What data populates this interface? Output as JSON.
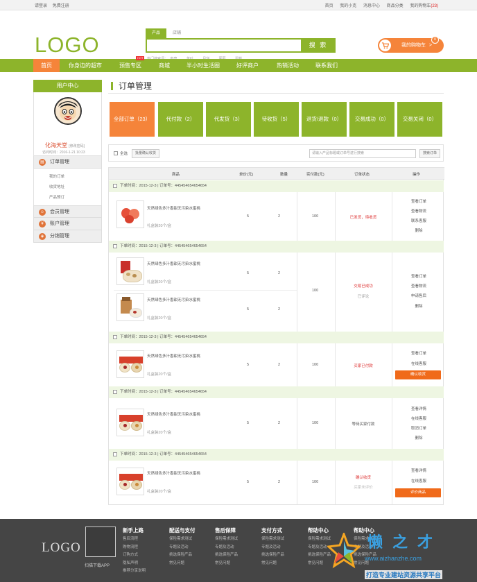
{
  "topbar": {
    "login": "请登录",
    "register": "免费注册",
    "links": [
      "首页",
      "我的小克",
      "消息中心",
      "商品分类",
      "我的购物车"
    ],
    "cart_count": "(23)"
  },
  "header": {
    "logo": "LOGO",
    "search_tabs": [
      "产品",
      "店铺"
    ],
    "search_button": "搜 索",
    "hot_label": "热门搜索词：",
    "hot_words": [
      "肉糜",
      "茶叶",
      "月饼",
      "葡萄",
      "蛋糕"
    ],
    "cart_label": "我的购物车",
    "cart_arrow": ">",
    "cart_badge": "0"
  },
  "nav": {
    "items": [
      "首页",
      "你身边的超市",
      "预售专区",
      "商城",
      "半小时生活圈",
      "好评商户",
      "热销活动",
      "联系我们"
    ],
    "hot_tag": "HOT"
  },
  "sidebar": {
    "title": "用户中心",
    "user_name": "化海天堂",
    "edit_password": "[修改密码]",
    "visit_time": "访问时间：2016-1-21 10:23",
    "sections": [
      {
        "label": "订单管理",
        "sub": [
          "我的订单",
          "收货地址",
          "产品预订"
        ]
      },
      {
        "label": "会员管理"
      },
      {
        "label": "账户管理"
      },
      {
        "label": "分销管理"
      }
    ]
  },
  "main": {
    "title": "订单管理",
    "status_tabs": [
      "全部订单（23）",
      "代付款（2）",
      "代发货（3）",
      "待收货（5）",
      "退货/退款（0）",
      "交易成功（0）",
      "交易关闭（0）"
    ],
    "select_all": "全选",
    "batch_confirm": "批量确认收货",
    "search_placeholder": "请输入产品标题或订单号进行搜索",
    "search_button": "搜索订单",
    "columns": [
      "商品",
      "单价(元)",
      "数量",
      "实付款(元)",
      "订单状态",
      "操作"
    ],
    "orders": [
      {
        "header": "下单时间：2015-12-3 | 订单号：445454654654654",
        "items": [
          {
            "name": "天然绿色多汁香甜无污染水蜜桃",
            "spec": "礼盒装20个/盒",
            "price": "5",
            "qty": "2"
          }
        ],
        "paid": "100",
        "status": [
          "已发货，待收货"
        ],
        "actions": [
          "查看订单",
          "查看物流",
          "联系客服",
          "删除"
        ],
        "button": ""
      },
      {
        "header": "下单时间：2015-12-3 | 订单号：445454654654654",
        "items": [
          {
            "name": "天然绿色多汁香甜无污染水蜜桃",
            "spec": "礼盒装20个/盒",
            "price": "5",
            "qty": "2"
          },
          {
            "name": "天然绿色多汁香甜无污染水蜜桃",
            "spec": "礼盒装20个/盒",
            "price": "5",
            "qty": "2"
          }
        ],
        "paid": "100",
        "status": [
          "交易已成功",
          "已评论"
        ],
        "actions": [
          "查看订单",
          "查看物流",
          "申请售后",
          "删除"
        ],
        "button": ""
      },
      {
        "header": "下单时间：2015-12-3 | 订单号：445454654654654",
        "items": [
          {
            "name": "天然绿色多汁香甜无污染水蜜桃",
            "spec": "礼盒装20个/盒",
            "price": "5",
            "qty": "2"
          }
        ],
        "paid": "100",
        "status": [
          "买家已付款"
        ],
        "actions": [
          "查看订单",
          "在线客服"
        ],
        "button": "确认收货"
      },
      {
        "header": "下单时间：2015-12-3 | 订单号：445454654654654",
        "items": [
          {
            "name": "天然绿色多汁香甜无污染水蜜桃",
            "spec": "礼盒装20个/盒",
            "price": "5",
            "qty": "2"
          }
        ],
        "paid": "100",
        "status": [
          "等待买家付款"
        ],
        "actions": [
          "查看详情",
          "在线客服",
          "取消订单",
          "删除"
        ],
        "button": ""
      },
      {
        "header": "下单时间：2015-12-3 | 订单号：445454654654654",
        "items": [
          {
            "name": "天然绿色多汁香甜无污染水蜜桃",
            "spec": "礼盒装20个/盒",
            "price": "5",
            "qty": "2"
          }
        ],
        "paid": "100",
        "status": [
          "确认收货",
          "买家未评价"
        ],
        "actions": [
          "查看详情",
          "在线客服"
        ],
        "button": "评价商品"
      }
    ]
  },
  "footer": {
    "logo": "LOGO",
    "qr_caption": "扫描下载APP",
    "columns": [
      {
        "title": "新手上路",
        "links": [
          "售后流程",
          "购物流程",
          "订购方式",
          "隐私声明",
          "推荐分享说明"
        ]
      },
      {
        "title": "配送与支付",
        "links": [
          "保险需求测试",
          "专题及活动",
          "挑选保险产品",
          "常见问题"
        ]
      },
      {
        "title": "售后保障",
        "links": [
          "保险需求测试",
          "专题及活动",
          "挑选保险产品",
          "常见问题"
        ]
      },
      {
        "title": "支付方式",
        "links": [
          "保险需求测试",
          "专题及活动",
          "挑选保险产品",
          "常见问题"
        ]
      },
      {
        "title": "帮助中心",
        "links": [
          "保险需求测试",
          "专题及活动",
          "挑选保险产品",
          "常见问题"
        ]
      },
      {
        "title": "帮助中心",
        "links": [
          "保险需求测试",
          "专题及活动",
          "挑选保险产品",
          "常见问题"
        ]
      }
    ]
  },
  "watermark": {
    "brand": "懒之才",
    "url": "www.aizhanzhe.com",
    "slogan": "打造专业建站资源共享平台"
  }
}
